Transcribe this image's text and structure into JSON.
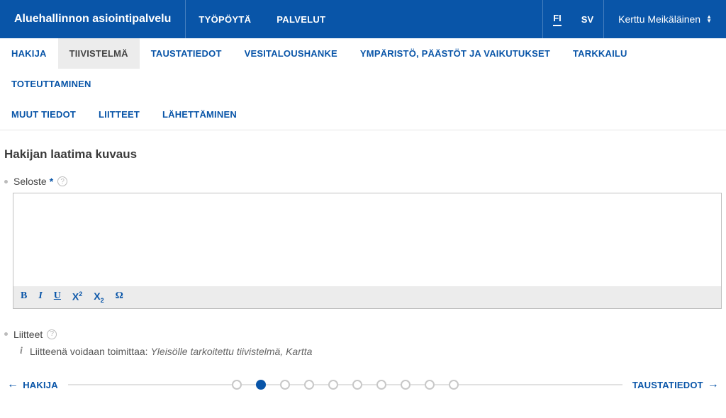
{
  "header": {
    "title": "Aluehallinnon asiointipalvelu",
    "nav": [
      "TYÖPÖYTÄ",
      "PALVELUT"
    ],
    "lang": {
      "fi": "FI",
      "sv": "SV",
      "active": "FI"
    },
    "user": "Kerttu Meikäläinen"
  },
  "tabs": {
    "row1": [
      "HAKIJA",
      "TIIVISTELMÄ",
      "TAUSTATIEDOT",
      "VESITALOUSHANKE",
      "YMPÄRISTÖ, PÄÄSTÖT JA VAIKUTUKSET",
      "TARKKAILU",
      "TOTEUTTAMINEN"
    ],
    "row2": [
      "MUUT TIEDOT",
      "LIITTEET",
      "LÄHETTÄMINEN"
    ],
    "active": "TIIVISTELMÄ"
  },
  "content": {
    "section_title": "Hakijan laatima kuvaus",
    "seloste_label": "Seloste",
    "seloste_value": "",
    "toolbar": {
      "bold": "B",
      "italic": "I",
      "underline": "U",
      "sup_prefix": "X",
      "sup_exp": "2",
      "sub_prefix": "X",
      "sub_exp": "2",
      "omega": "Ω"
    },
    "attachments_label": "Liitteet",
    "attachments_info_prefix": "Liitteenä voidaan toimittaa: ",
    "attachments_info_em": "Yleisölle tarkoitettu tiivistelmä, Kartta"
  },
  "footer": {
    "prev": "HAKIJA",
    "next": "TAUSTATIEDOT",
    "total_steps": 10,
    "active_step": 2
  }
}
